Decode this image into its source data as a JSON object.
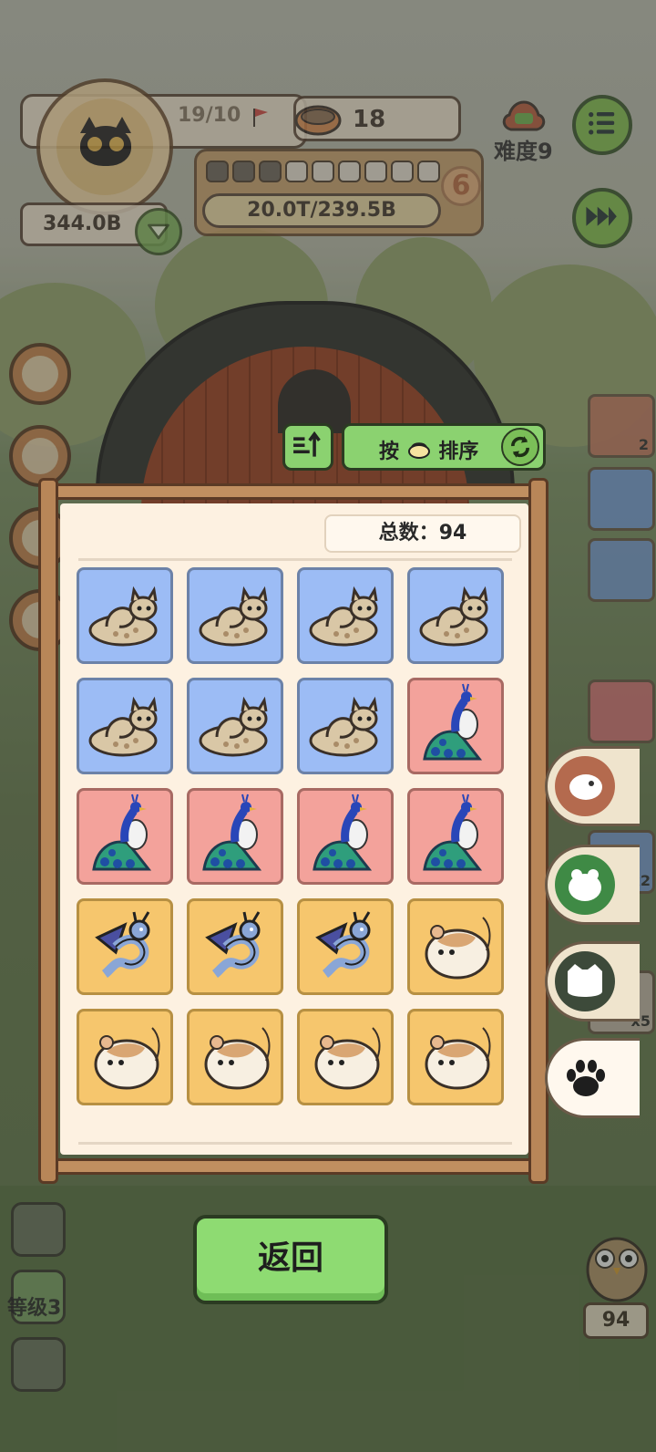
{
  "hud": {
    "progress": "19/10",
    "bowl_count": "18",
    "segments_filled": 3,
    "segments_total": 9,
    "level": "6",
    "energy": "20.0T/239.5B",
    "coins": "344.0B",
    "difficulty": "难度9"
  },
  "sort": {
    "prefix": "按",
    "suffix": "排序"
  },
  "panel": {
    "total_label": "总数：",
    "total_value": "94"
  },
  "collection": [
    {
      "animal": "cat",
      "bg": "blue"
    },
    {
      "animal": "cat",
      "bg": "blue"
    },
    {
      "animal": "cat",
      "bg": "blue"
    },
    {
      "animal": "cat",
      "bg": "blue"
    },
    {
      "animal": "cat",
      "bg": "blue"
    },
    {
      "animal": "cat",
      "bg": "blue"
    },
    {
      "animal": "cat",
      "bg": "blue"
    },
    {
      "animal": "peacock",
      "bg": "red"
    },
    {
      "animal": "peacock",
      "bg": "red"
    },
    {
      "animal": "peacock",
      "bg": "red"
    },
    {
      "animal": "peacock",
      "bg": "red"
    },
    {
      "animal": "peacock",
      "bg": "red"
    },
    {
      "animal": "dragon",
      "bg": "yellow"
    },
    {
      "animal": "dragon",
      "bg": "yellow"
    },
    {
      "animal": "dragon",
      "bg": "yellow"
    },
    {
      "animal": "hamster",
      "bg": "yellow"
    },
    {
      "animal": "hamster",
      "bg": "yellow"
    },
    {
      "animal": "hamster",
      "bg": "yellow"
    },
    {
      "animal": "hamster",
      "bg": "yellow"
    },
    {
      "animal": "hamster",
      "bg": "yellow"
    }
  ],
  "side_badges": {
    "card1": "2",
    "card_bag": "x2",
    "card_rope": "x5"
  },
  "bottom": {
    "level_label": "等级3",
    "owl_count": "94",
    "back_label": "返回"
  },
  "colors": {
    "blue_tile": "#9cbcf5",
    "red_tile": "#f3a29b",
    "yellow_tile": "#f6c66d",
    "button_green": "#8edb72"
  }
}
